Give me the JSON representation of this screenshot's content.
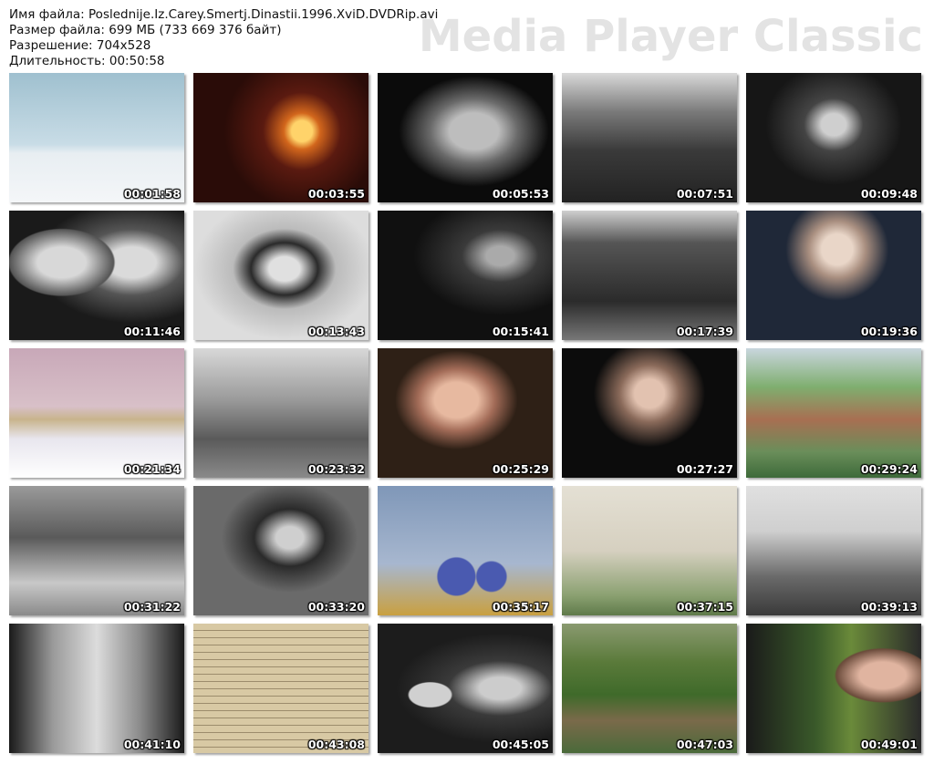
{
  "header": {
    "file_name": "Имя файла: Poslednije.Iz.Carey.Smertj.Dinastii.1996.XviD.DVDRip.avi",
    "file_size": "Размер файла: 699 МБ (733 669 376 байт)",
    "resolution": "Разрешение: 704x528",
    "duration": "Длительность: 00:50:58"
  },
  "brand": "Media Player Classic",
  "thumbnails": [
    {
      "time": "00:01:58",
      "scene": "statue-snow"
    },
    {
      "time": "00:03:55",
      "scene": "fireplace"
    },
    {
      "time": "00:05:53",
      "scene": "bw-profile"
    },
    {
      "time": "00:07:51",
      "scene": "bw-crowd"
    },
    {
      "time": "00:09:48",
      "scene": "bw-woman-hat"
    },
    {
      "time": "00:11:46",
      "scene": "bw-girls"
    },
    {
      "time": "00:13:43",
      "scene": "bw-woman-portrait"
    },
    {
      "time": "00:15:41",
      "scene": "bw-man-reading"
    },
    {
      "time": "00:17:39",
      "scene": "bw-train"
    },
    {
      "time": "00:19:36",
      "scene": "old-man-interview"
    },
    {
      "time": "00:21:34",
      "scene": "palace-winter"
    },
    {
      "time": "00:23:32",
      "scene": "bw-cart"
    },
    {
      "time": "00:25:29",
      "scene": "man-library"
    },
    {
      "time": "00:27:27",
      "scene": "old-man-dark"
    },
    {
      "time": "00:29:24",
      "scene": "town-view"
    },
    {
      "time": "00:31:22",
      "scene": "bw-group-sitting"
    },
    {
      "time": "00:33:20",
      "scene": "bw-speaker-crowd"
    },
    {
      "time": "00:35:17",
      "scene": "church-domes"
    },
    {
      "time": "00:37:15",
      "scene": "house-facade"
    },
    {
      "time": "00:39:13",
      "scene": "kremlin-tower"
    },
    {
      "time": "00:41:10",
      "scene": "bw-building-trees"
    },
    {
      "time": "00:43:08",
      "scene": "document"
    },
    {
      "time": "00:45:05",
      "scene": "bw-soldiers"
    },
    {
      "time": "00:47:03",
      "scene": "forest-clearing"
    },
    {
      "time": "00:49:01",
      "scene": "crowd-outdoor"
    }
  ],
  "colors": {
    "background": "#ffffff",
    "brand_text": "#e3e3e3",
    "header_text": "#111111",
    "timestamp_text": "#ffffff"
  }
}
